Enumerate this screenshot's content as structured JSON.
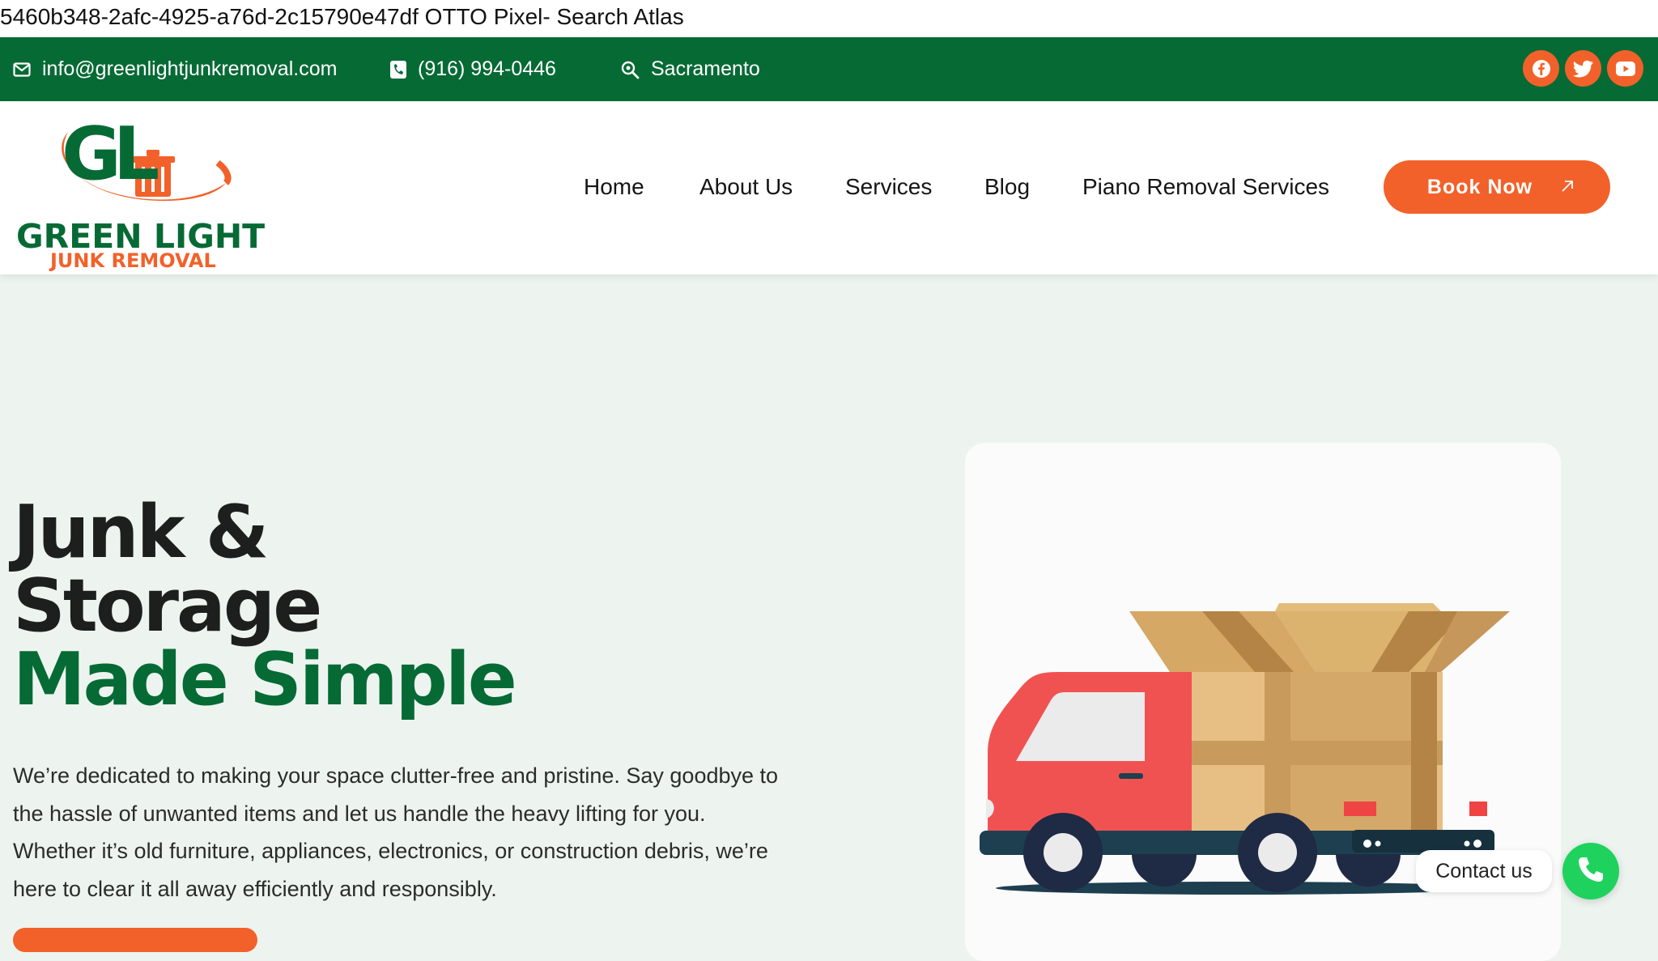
{
  "debug": {
    "text": "5460b348-2afc-4925-a76d-2c15790e47df OTTO Pixel- Search Atlas"
  },
  "topbar": {
    "email": "info@greenlightjunkremoval.com",
    "phone": "(916) 994-0446",
    "location": "Sacramento",
    "social": [
      "facebook-icon",
      "twitter-icon",
      "youtube-icon"
    ]
  },
  "logo": {
    "mark": "GL",
    "line1": "GREEN LIGHT",
    "line2": "JUNK REMOVAL"
  },
  "nav": {
    "items": [
      "Home",
      "About Us",
      "Services",
      "Blog",
      "Piano Removal Services"
    ],
    "cta": "Book Now"
  },
  "hero": {
    "title_line1": "Junk &",
    "title_line2": "Storage",
    "title_line3": "Made Simple",
    "description": "We’re dedicated to making your space clutter-free and pristine. Say goodbye to the hassle of unwanted items and let us handle the heavy lifting for you. Whether it’s old furniture, appliances, electronics, or construction debris, we’re here to clear it all away efficiently and responsibly."
  },
  "widget": {
    "contact_label": "Contact us"
  },
  "colors": {
    "brand_green": "#066a35",
    "accent_orange": "#f2612a",
    "hero_bg": "#edf4ef",
    "whatsapp_green": "#1fd25e"
  }
}
